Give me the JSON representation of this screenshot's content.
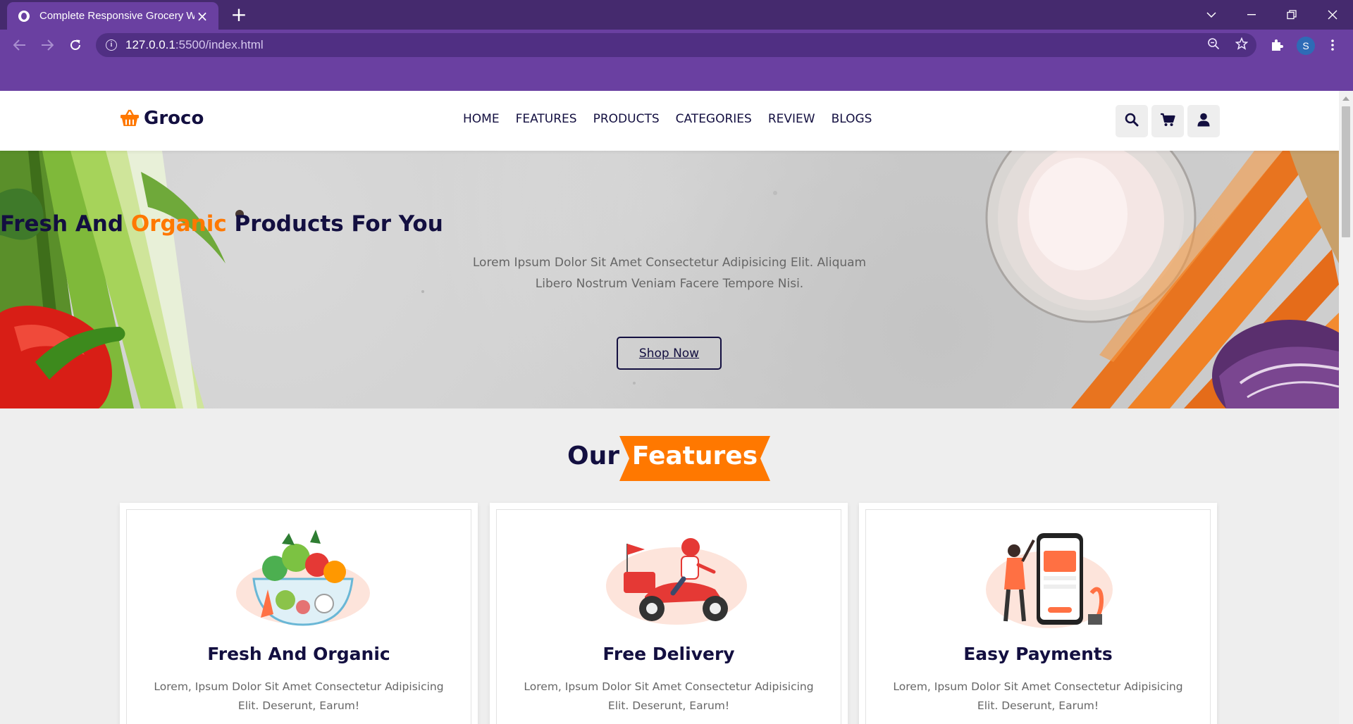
{
  "browser": {
    "tab_title": "Complete Responsive Grocery W",
    "tab_close": "×",
    "new_tab": "+",
    "url_host": "127.0.0.1",
    "url_path": ":5500/index.html",
    "profile_initial": "S"
  },
  "site": {
    "logo": "Groco",
    "nav": [
      "HOME",
      "FEATURES",
      "PRODUCTS",
      "CATEGORIES",
      "REVIEW",
      "BLOGS"
    ],
    "header_icons": [
      "search-icon",
      "cart-icon",
      "user-icon"
    ]
  },
  "hero": {
    "title_before": "Fresh And ",
    "title_accent": "Organic",
    "title_after": " Products For You",
    "text": "Lorem Ipsum Dolor Sit Amet Consectetur Adipisicing Elit. Aliquam Libero Nostrum Veniam Facere Tempore Nisi.",
    "button": "Shop Now"
  },
  "features": {
    "heading_plain": "Our",
    "heading_badge": "Features",
    "cards": [
      {
        "title": "Fresh And Organic",
        "text": "Lorem, Ipsum Dolor Sit Amet Consectetur Adipisicing Elit. Deserunt, Earum!",
        "icon": "vegetable-bowl-illustration"
      },
      {
        "title": "Free Delivery",
        "text": "Lorem, Ipsum Dolor Sit Amet Consectetur Adipisicing Elit. Deserunt, Earum!",
        "icon": "delivery-scooter-illustration"
      },
      {
        "title": "Easy Payments",
        "text": "Lorem, Ipsum Dolor Sit Amet Consectetur Adipisicing Elit. Deserunt, Earum!",
        "icon": "mobile-payment-illustration"
      }
    ]
  },
  "colors": {
    "brand_dark": "#130f40",
    "accent": "#ff7800",
    "browser_frame": "#452a6e",
    "browser_toolbar": "#6a40a1"
  }
}
